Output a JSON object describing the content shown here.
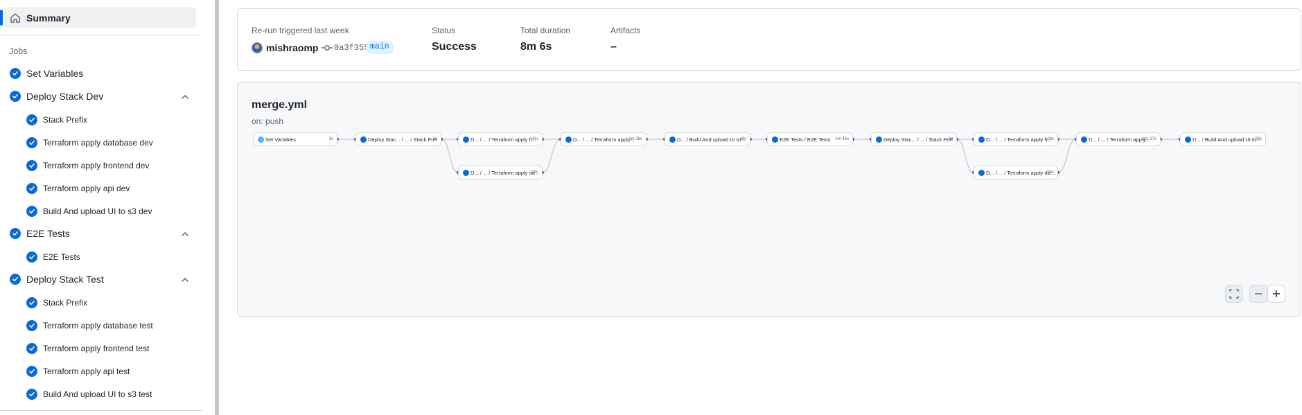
{
  "sidebar": {
    "summary_label": "Summary",
    "jobs_heading": "Jobs",
    "groups": [
      {
        "label": "Set Variables",
        "expandable": false,
        "steps": []
      },
      {
        "label": "Deploy Stack Dev",
        "expandable": true,
        "steps": [
          "Stack Prefix",
          "Terraform apply database dev",
          "Terraform apply frontend dev",
          "Terraform apply api dev",
          "Build And upload UI to s3 dev"
        ]
      },
      {
        "label": "E2E Tests",
        "expandable": true,
        "steps": [
          "E2E Tests"
        ]
      },
      {
        "label": "Deploy Stack Test",
        "expandable": true,
        "steps": [
          "Stack Prefix",
          "Terraform apply database test",
          "Terraform apply frontend test",
          "Terraform apply api test",
          "Build And upload UI to s3 test"
        ]
      }
    ]
  },
  "run": {
    "trigger_label": "Re-run triggered last week",
    "actor": "mishraomp",
    "commit_sha": "0a3f355",
    "branch": "main",
    "status_label": "Status",
    "status_value": "Success",
    "duration_label": "Total duration",
    "duration_value": "8m 6s",
    "artifacts_label": "Artifacts",
    "artifacts_value": "–"
  },
  "workflow": {
    "file": "merge.yml",
    "trigger": "on: push",
    "nodes": [
      {
        "id": "n1",
        "label": "Set Variables",
        "duration": "3s"
      },
      {
        "id": "n2",
        "label": "Deploy Stac... / ... / Stack Prefix",
        "duration": "3s"
      },
      {
        "id": "n3",
        "label": "D... / ... / Terraform apply fr...",
        "duration": "41s"
      },
      {
        "id": "n4",
        "label": "D... / ... / Terraform apply da...",
        "duration": "19s"
      },
      {
        "id": "n5",
        "label": "D... / ... / Terraform apply...",
        "duration": "1m 38s"
      },
      {
        "id": "n6",
        "label": "D... / Build And upload UI to...",
        "duration": "48s"
      },
      {
        "id": "n7",
        "label": "E2E Tests / E2E Tests",
        "duration": "1m 45s"
      },
      {
        "id": "n8",
        "label": "Deploy Stac... / ... / Stack Prefix",
        "duration": "3s"
      },
      {
        "id": "n9",
        "label": "D... / ... / Terraform apply fr...",
        "duration": "28s"
      },
      {
        "id": "n10",
        "label": "D... / ... / Terraform apply da...",
        "duration": "15s"
      },
      {
        "id": "n11",
        "label": "D... / ... / Terraform apply...",
        "duration": "1m 27s"
      },
      {
        "id": "n12",
        "label": "D... / Build And upload UI to...",
        "duration": "28s"
      }
    ]
  },
  "colors": {
    "accent": "#0969da",
    "success": "#0969da",
    "branch_bg": "#ddf4ff"
  },
  "icons": {
    "summary": "home-icon",
    "check": "check-circle-icon",
    "expand": "chevron-up-icon",
    "commit": "git-commit-icon",
    "fullscreen": "fullscreen-icon",
    "zoom_out": "minus-icon",
    "zoom_in": "plus-icon"
  }
}
